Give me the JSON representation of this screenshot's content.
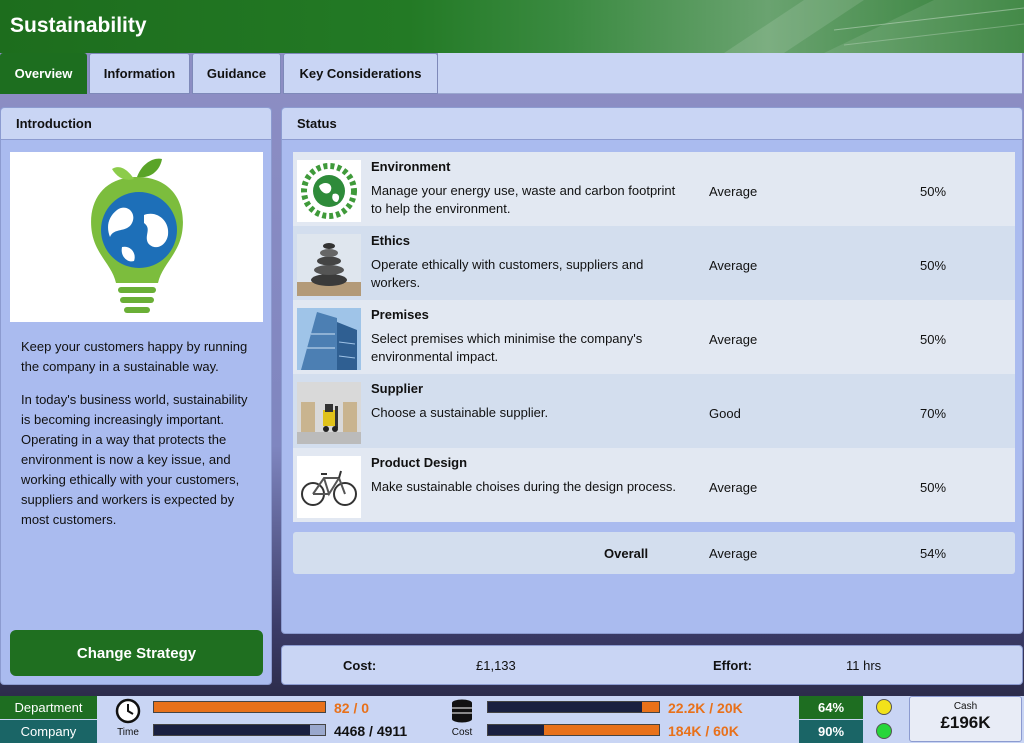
{
  "window": {
    "title": "Sustainability"
  },
  "tabs": [
    {
      "label": "Overview",
      "active": true
    },
    {
      "label": "Information",
      "active": false
    },
    {
      "label": "Guidance",
      "active": false
    },
    {
      "label": "Key Considerations",
      "active": false
    }
  ],
  "intro": {
    "header": "Introduction",
    "image_icon": "lightbulb-globe-icon",
    "paragraphs": [
      "Keep your customers happy by running the company in a sustainable way.",
      "In today's business world, sustainability is becoming increasingly important. Operating in a way that protects the environment is now a key issue, and working ethically with your customers, suppliers and workers is expected by most customers."
    ],
    "button_label": "Change Strategy"
  },
  "status": {
    "header": "Status",
    "rows": [
      {
        "title": "Environment",
        "desc": "Manage your energy use, waste and carbon footprint to help the environment.",
        "rating": "Average",
        "pct": "50%",
        "icon": "green-globe-icon"
      },
      {
        "title": "Ethics",
        "desc": "Operate ethically with customers, suppliers and workers.",
        "rating": "Average",
        "pct": "50%",
        "icon": "stacked-stones-icon"
      },
      {
        "title": "Premises",
        "desc": "Select premises which minimise the company's environmental impact.",
        "rating": "Average",
        "pct": "50%",
        "icon": "office-building-icon"
      },
      {
        "title": "Supplier",
        "desc": "Choose a sustainable supplier.",
        "rating": "Good",
        "pct": "70%",
        "icon": "forklift-warehouse-icon"
      },
      {
        "title": "Product Design",
        "desc": "Make sustainable choises during the design process.",
        "rating": "Average",
        "pct": "50%",
        "icon": "bicycle-icon"
      }
    ],
    "overall": {
      "label": "Overall",
      "rating": "Average",
      "pct": "54%"
    }
  },
  "cost_bar": {
    "cost_label": "Cost:",
    "cost_value": "£1,133",
    "effort_label": "Effort:",
    "effort_value": "11 hrs"
  },
  "bottom": {
    "department_label": "Department",
    "company_label": "Company",
    "time_label": "Time",
    "cost_label": "Cost",
    "time_dept": {
      "text": "82 / 0",
      "fraction": 1.0,
      "color": "#e8711a"
    },
    "time_comp": {
      "text": "4468 / 4911",
      "fraction": 0.91,
      "color": "#1a2040"
    },
    "cost_dept": {
      "text": "22.2K / 20K",
      "fraction": 0.9,
      "color": "#1a2040",
      "over_color": "#e8711a"
    },
    "cost_comp": {
      "text": "184K / 60K",
      "fraction": 0.33,
      "color": "#1a2040",
      "over_color": "#e8711a"
    },
    "satisfaction_dept": "64%",
    "satisfaction_comp": "90%",
    "smiley_dept_color": "#f2e21a",
    "smiley_comp_color": "#27d63a",
    "cash_label": "Cash",
    "cash_value": "£196K"
  },
  "colors": {
    "accent": "#1d6e1f",
    "panel": "#aabbef",
    "header": "#c9d5f4",
    "orange": "#e8711a"
  }
}
